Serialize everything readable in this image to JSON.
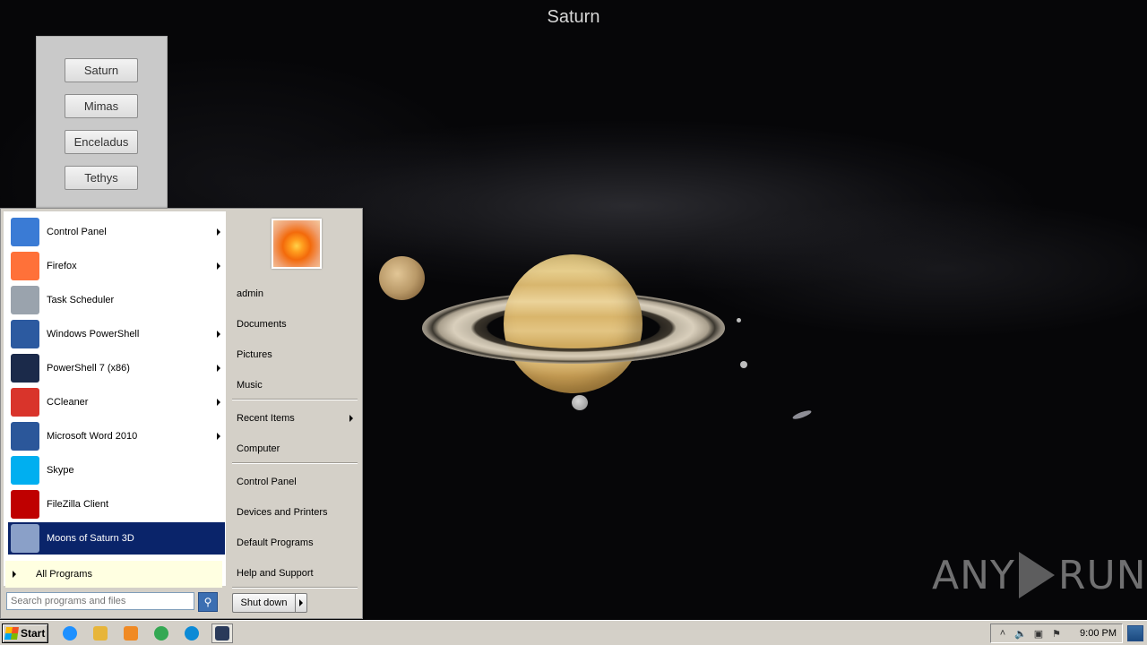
{
  "app": {
    "title": "Saturn"
  },
  "moons_panel": {
    "buttons": [
      "Saturn",
      "Mimas",
      "Enceladus",
      "Tethys"
    ]
  },
  "watermark": {
    "left": "ANY",
    "right": "RUN"
  },
  "start_menu": {
    "programs": [
      {
        "label": "Control Panel",
        "icon": "control-panel-icon",
        "submenu": true,
        "color": "#3a7bd5"
      },
      {
        "label": "Firefox",
        "icon": "firefox-icon",
        "submenu": true,
        "color": "#ff7139"
      },
      {
        "label": "Task Scheduler",
        "icon": "clock-icon",
        "submenu": false,
        "color": "#9aa3ad"
      },
      {
        "label": "Windows PowerShell",
        "icon": "powershell-icon",
        "submenu": true,
        "color": "#2c5aa0"
      },
      {
        "label": "PowerShell 7 (x86)",
        "icon": "powershell-icon",
        "submenu": true,
        "color": "#1b2a4a"
      },
      {
        "label": "CCleaner",
        "icon": "ccleaner-icon",
        "submenu": true,
        "color": "#d9342b"
      },
      {
        "label": "Microsoft Word 2010",
        "icon": "word-icon",
        "submenu": true,
        "color": "#2b579a"
      },
      {
        "label": "Skype",
        "icon": "skype-icon",
        "submenu": false,
        "color": "#00aff0"
      },
      {
        "label": "FileZilla Client",
        "icon": "filezilla-icon",
        "submenu": false,
        "color": "#bf0000"
      },
      {
        "label": "Moons of Saturn 3D",
        "icon": "saturn-app-icon",
        "submenu": false,
        "color": "#8aa0c8",
        "active": true
      }
    ],
    "all_programs": "All Programs",
    "search_placeholder": "Search programs and files",
    "places": {
      "user": "admin",
      "documents": "Documents",
      "pictures": "Pictures",
      "music": "Music",
      "recent_items": "Recent Items",
      "computer": "Computer",
      "control_panel": "Control Panel",
      "devices_printers": "Devices and Printers",
      "default_programs": "Default Programs",
      "help_support": "Help and Support"
    },
    "shutdown": "Shut down"
  },
  "taskbar": {
    "start": "Start",
    "clock": "9:00 PM",
    "icons": [
      {
        "name": "ie-icon",
        "color": "#1e90ff"
      },
      {
        "name": "explorer-icon",
        "color": "#e7b53a"
      },
      {
        "name": "media-player-icon",
        "color": "#f08a24"
      },
      {
        "name": "chrome-icon",
        "color": "#34a853"
      },
      {
        "name": "edge-icon",
        "color": "#0c8ad6"
      },
      {
        "name": "saturn-app-icon",
        "color": "#2a3a5a"
      }
    ]
  }
}
